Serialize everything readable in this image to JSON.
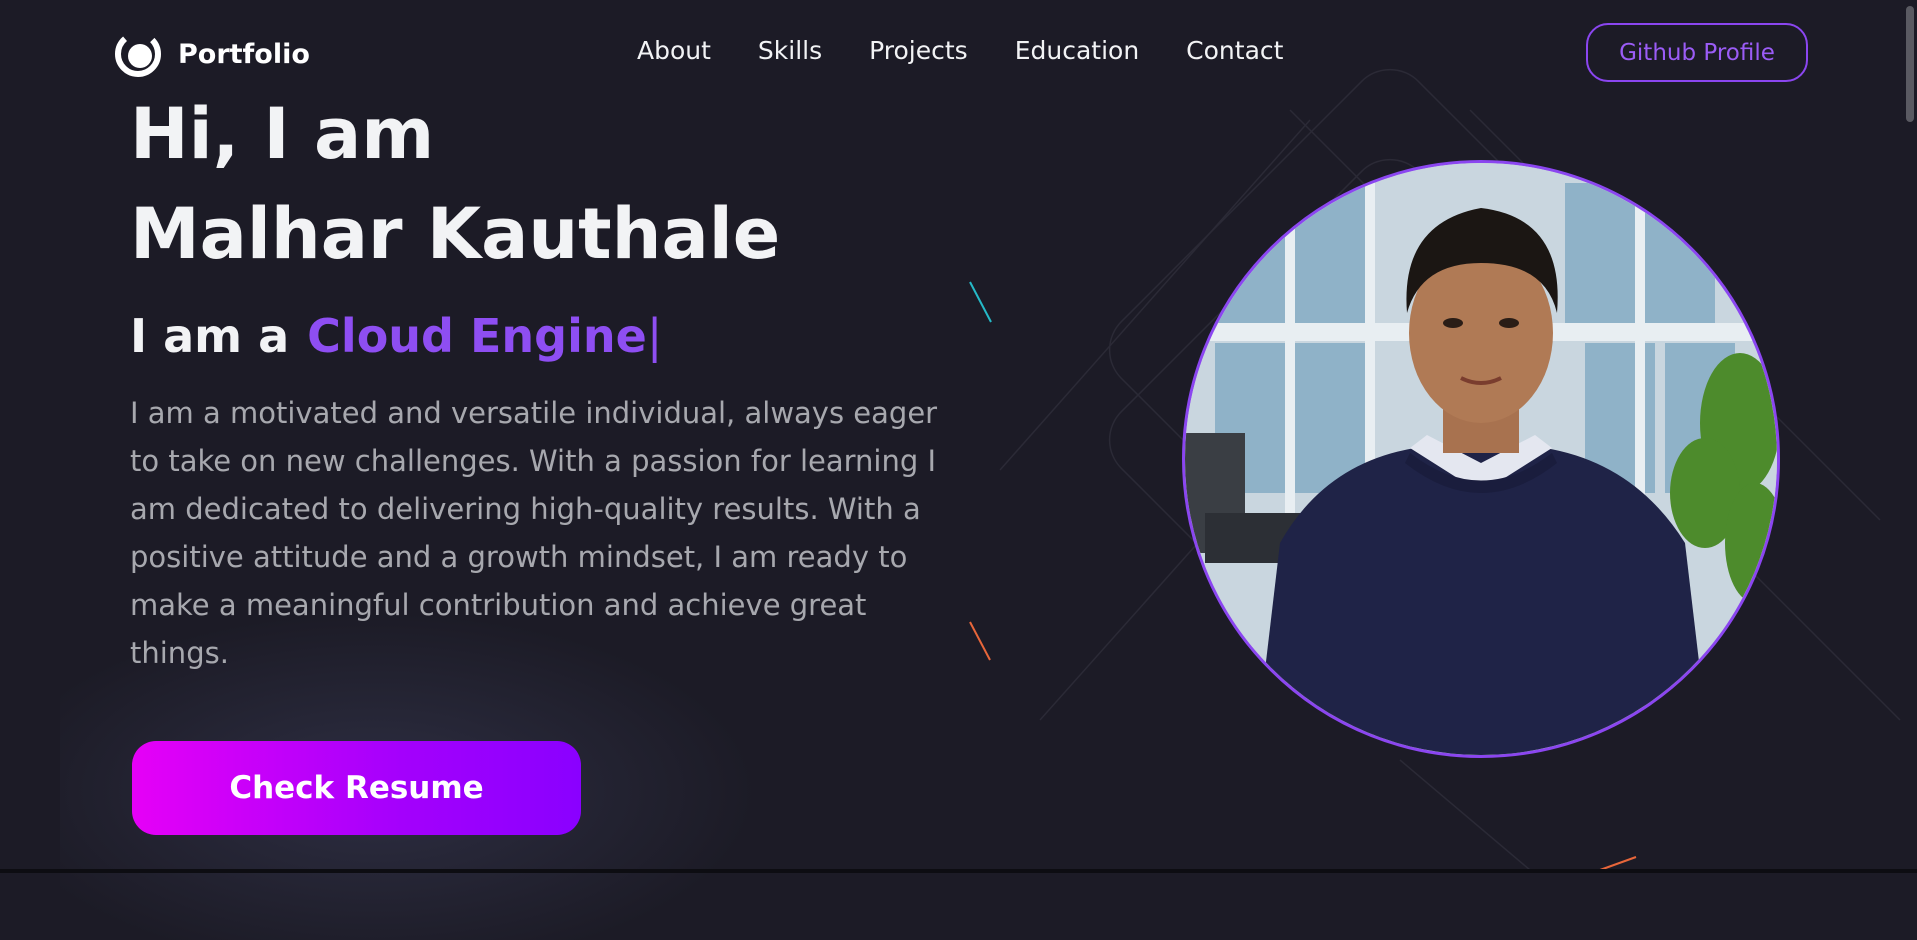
{
  "nav": {
    "brand": "Portfolio",
    "links": [
      "About",
      "Skills",
      "Projects",
      "Education",
      "Contact"
    ],
    "github_label": "Github Profile"
  },
  "hero": {
    "greeting": "Hi, I am",
    "name": "Malhar Kauthale",
    "role_prefix": "I am a",
    "role_typed": "Cloud Engine",
    "cursor": "|",
    "bio": "I am a motivated and versatile individual, always eager to take on new challenges. With a passion for learning I am dedicated to delivering high-quality results. With a positive attitude and a growth mindset, I am ready to make a meaningful contribution and achieve great things.",
    "resume_label": "Check Resume"
  },
  "colors": {
    "background": "#1c1b26",
    "accent": "#8b46f0",
    "button_gradient_start": "#e600f7",
    "button_gradient_end": "#8a00ff"
  },
  "icons": {
    "brand_logo": "portfolio-logo-icon"
  }
}
